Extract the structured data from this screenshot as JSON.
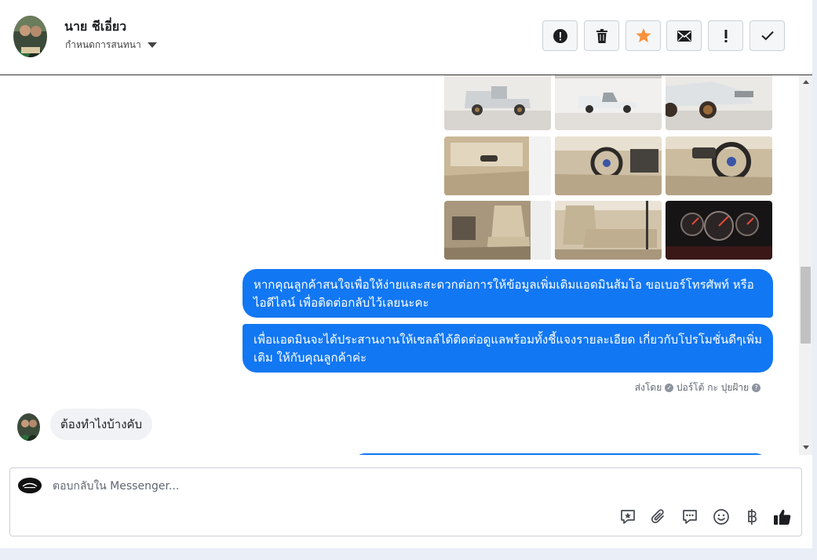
{
  "header": {
    "name": "นาย ชีเอี่ยว",
    "subtitle": "กำหนดการสนทนา",
    "actions": [
      {
        "icon": "alert-circle-icon"
      },
      {
        "icon": "trash-icon"
      },
      {
        "icon": "star-icon"
      },
      {
        "icon": "mail-icon"
      },
      {
        "icon": "exclamation-icon"
      },
      {
        "icon": "check-icon"
      }
    ]
  },
  "messages": {
    "outgoing": [
      "หากคุณลูกค้าสนใจเพื่อให้ง่ายและสะดวกต่อการให้ข้อมูลเพิ่มเติมแอดมินส้มโอ ขอเบอร์โทรศัพท์ หรือ ไอดีไลน์ เพื่อติดต่อกลับไว้เลยนะคะ",
      "เพื่อแอดมินจะได้ประสานงานให้เซลล์ได้ติดต่อดูแลพร้อมทั้งชี้แจงรายละเอียด เกี่ยวกับโปรโมชั่นดีๆเพิ่มเติม ให้กับคุณลูกค้าค่ะ"
    ],
    "sent_by_prefix": "ส่งโดย",
    "sent_by_name": "ปอร์โต้ กะ ปุยฝ้าย",
    "incoming": "ต้องทำไงบ้างคับ"
  },
  "composer": {
    "placeholder": "ตอบกลับใน Messenger...",
    "icons": [
      "saved-reply-icon",
      "attachment-icon",
      "chat-bubble-icon",
      "emoji-icon",
      "baht-payment-icon",
      "like-icon"
    ]
  },
  "colors": {
    "bubble_out": "#1277f2",
    "bubble_in": "#f0f2f5",
    "star": "#f7923b"
  }
}
